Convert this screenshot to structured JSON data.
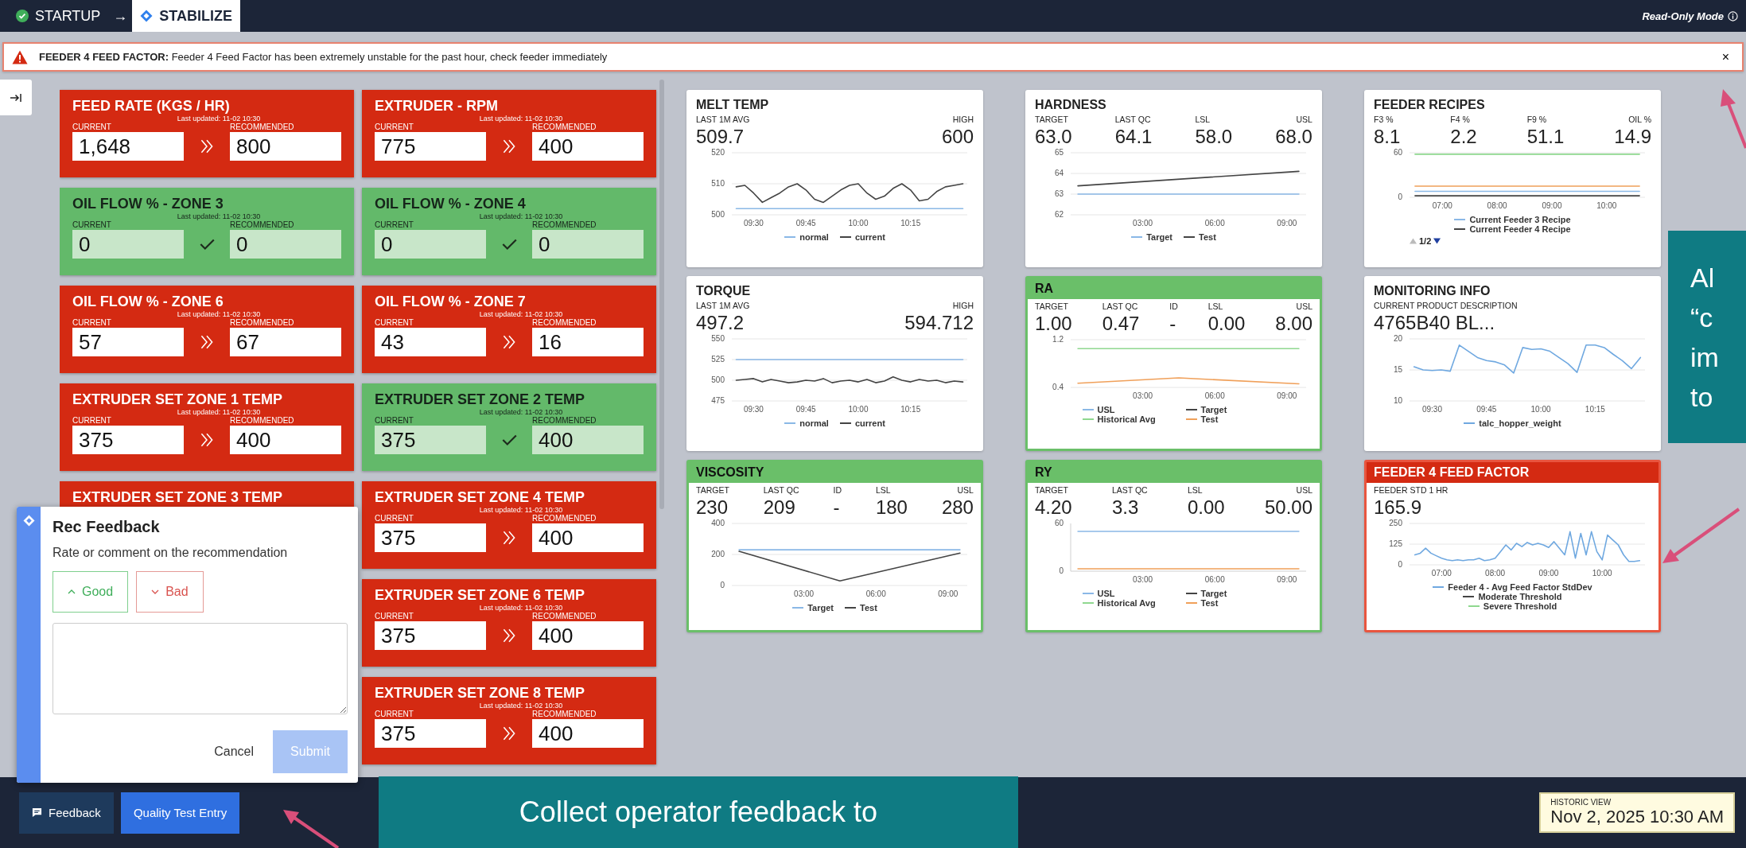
{
  "topbar": {
    "steps": [
      {
        "label": "STARTUP",
        "kind": "done",
        "selected": false
      },
      {
        "label": "STABILIZE",
        "kind": "current",
        "selected": true
      }
    ],
    "step_separator": "→",
    "mode": "Read-Only Mode"
  },
  "alert": {
    "title": "FEEDER 4 FEED FACTOR:",
    "message": "Feeder 4 Feed Factor has been extremely unstable for the past hour, check feeder immediately",
    "close": "×"
  },
  "setpoints": {
    "columns": [
      [
        {
          "title": "FEED RATE (KGS / HR)",
          "kind": "alert",
          "updated": "Last updated: 11-02 10:30",
          "current_label": "CURRENT",
          "current": "1,648",
          "recommended_label": "RECOMMENDED",
          "recommended": "800"
        },
        {
          "title": "OIL FLOW % - ZONE 3",
          "kind": "ok",
          "updated": "Last updated: 11-02 10:30",
          "current_label": "CURRENT",
          "current": "0",
          "recommended_label": "RECOMMENDED",
          "recommended": "0"
        },
        {
          "title": "OIL FLOW % - ZONE 6",
          "kind": "alert",
          "updated": "Last updated: 11-02 10:30",
          "current_label": "CURRENT",
          "current": "57",
          "recommended_label": "RECOMMENDED",
          "recommended": "67"
        },
        {
          "title": "EXTRUDER SET ZONE 1 TEMP",
          "kind": "alert",
          "updated": "Last updated: 11-02 10:30",
          "current_label": "CURRENT",
          "current": "375",
          "recommended_label": "RECOMMENDED",
          "recommended": "400"
        },
        {
          "title": "EXTRUDER SET ZONE 3 TEMP",
          "kind": "alert"
        }
      ],
      [
        {
          "title": "EXTRUDER - RPM",
          "kind": "alert",
          "updated": "Last updated: 11-02 10:30",
          "current_label": "CURRENT",
          "current": "775",
          "recommended_label": "RECOMMENDED",
          "recommended": "400"
        },
        {
          "title": "OIL FLOW % - ZONE 4",
          "kind": "ok",
          "updated": "Last updated: 11-02 10:30",
          "current_label": "CURRENT",
          "current": "0",
          "recommended_label": "RECOMMENDED",
          "recommended": "0"
        },
        {
          "title": "OIL FLOW % - ZONE 7",
          "kind": "alert",
          "updated": "Last updated: 11-02 10:30",
          "current_label": "CURRENT",
          "current": "43",
          "recommended_label": "RECOMMENDED",
          "recommended": "16"
        },
        {
          "title": "EXTRUDER SET ZONE 2 TEMP",
          "kind": "ok",
          "updated": "Last updated: 11-02 10:30",
          "current_label": "CURRENT",
          "current": "375",
          "recommended_label": "RECOMMENDED",
          "recommended": "400"
        },
        {
          "title": "EXTRUDER SET ZONE 4 TEMP",
          "kind": "alert",
          "updated": "Last updated: 11-02 10:30",
          "current_label": "CURRENT",
          "current": "375",
          "recommended_label": "RECOMMENDED",
          "recommended": "400"
        },
        {
          "title": "EXTRUDER SET ZONE 6 TEMP",
          "kind": "alert",
          "updated": "Last updated: 11-02 10:30",
          "current_label": "CURRENT",
          "current": "375",
          "recommended_label": "RECOMMENDED",
          "recommended": "400"
        },
        {
          "title": "EXTRUDER SET ZONE 8 TEMP",
          "kind": "alert",
          "updated": "Last updated: 11-02 10:30",
          "current_label": "CURRENT",
          "current": "375",
          "recommended_label": "RECOMMENDED",
          "recommended": "400"
        }
      ]
    ]
  },
  "panels": [
    {
      "title": "MELT TEMP",
      "kind": "plain",
      "stats": [
        {
          "label": "LAST 1M AVG",
          "value": "509.7"
        },
        {
          "label": "HIGH",
          "value": "600"
        }
      ],
      "chart_data": {
        "type": "line",
        "grid": true,
        "categories": [
          null,
          null,
          "09:30",
          null,
          null,
          null,
          null,
          null,
          "09:45",
          null,
          null,
          null,
          null,
          null,
          "10:00",
          null,
          null,
          null,
          null,
          null,
          "10:15",
          null,
          null,
          null,
          null,
          null,
          null
        ],
        "ylim": [
          500,
          520
        ],
        "yticks": [
          500,
          510,
          520
        ],
        "series": [
          {
            "name": "normal",
            "color": "#8ab8e6",
            "values": [
              502,
              502,
              502,
              502,
              502,
              502,
              502,
              502,
              502,
              502,
              502,
              502,
              502,
              502,
              502,
              502,
              502,
              502,
              502,
              502,
              502,
              502,
              502,
              502,
              502,
              502,
              502
            ]
          },
          {
            "name": "current",
            "color": "#444444",
            "values": [
              509,
              509.5,
              507,
              504,
              505.5,
              507,
              509,
              510,
              508,
              505,
              504,
              506,
              508,
              509.5,
              510,
              507,
              505,
              506,
              508.5,
              510,
              508,
              504.5,
              505,
              507.5,
              509,
              509.5,
              510
            ]
          }
        ]
      }
    },
    {
      "title": "HARDNESS",
      "kind": "plain",
      "stats": [
        {
          "label": "TARGET",
          "value": "63.0"
        },
        {
          "label": "LAST QC",
          "value": "64.1"
        },
        {
          "label": "LSL",
          "value": "58.0"
        },
        {
          "label": "USL",
          "value": "68.0"
        }
      ],
      "chart_data": {
        "type": "line",
        "grid": true,
        "x": [
          0.3,
          9.5
        ],
        "xlim": [
          0,
          9.8
        ],
        "ylim": [
          62,
          65
        ],
        "yticks": [
          62,
          63,
          64,
          65
        ],
        "xticks": [
          {
            "value": 3,
            "label": "03:00"
          },
          {
            "value": 6,
            "label": "06:00"
          },
          {
            "value": 9,
            "label": "09:00"
          }
        ],
        "series": [
          {
            "name": "Target",
            "color": "#8ab8e6",
            "values": [
              63,
              63
            ]
          },
          {
            "name": "Test",
            "color": "#444444",
            "values": [
              63.4,
              64.1
            ]
          }
        ]
      }
    },
    {
      "title": "FEEDER RECIPES",
      "kind": "plain",
      "stats": [
        {
          "label": "F3 %",
          "value": "8.1"
        },
        {
          "label": "F4 %",
          "value": "2.2"
        },
        {
          "label": "F9 %",
          "value": "51.1"
        },
        {
          "label": "OIL %",
          "value": "14.9"
        }
      ],
      "legend_pager": {
        "label": "1/2",
        "prev_disabled": true,
        "next_disabled": false
      },
      "chart_data": {
        "type": "line",
        "grid": true,
        "x": [
          6.5,
          10.6
        ],
        "xlim": [
          6.4,
          10.7
        ],
        "ylim": [
          0,
          60
        ],
        "yticks": [
          0,
          60
        ],
        "xticks": [
          {
            "value": 7,
            "label": "07:00"
          },
          {
            "value": 8,
            "label": "08:00"
          },
          {
            "value": 9,
            "label": "09:00"
          },
          {
            "value": 10,
            "label": "10:00"
          }
        ],
        "series": [
          {
            "name": "Current Feeder 3 Recipe",
            "color": "#8ab8e6",
            "values": [
              8,
              8
            ]
          },
          {
            "name": "Current Feeder 4 Recipe",
            "color": "#444444",
            "values": [
              2,
              2
            ]
          },
          {
            "name": null,
            "color": "#f0a05a",
            "values": [
              15,
              15
            ]
          },
          {
            "name": null,
            "color": "#8fd88f",
            "values": [
              58,
              58
            ]
          }
        ]
      }
    },
    {
      "title": "TORQUE",
      "kind": "plain",
      "stats": [
        {
          "label": "LAST 1M AVG",
          "value": "497.2"
        },
        {
          "label": "HIGH",
          "value": "594.712"
        }
      ],
      "chart_data": {
        "type": "line",
        "grid": true,
        "categories": [
          null,
          null,
          "09:30",
          null,
          null,
          null,
          null,
          null,
          "09:45",
          null,
          null,
          null,
          null,
          null,
          "10:00",
          null,
          null,
          null,
          null,
          null,
          "10:15",
          null,
          null,
          null,
          null,
          null,
          null
        ],
        "ylim": [
          475,
          550
        ],
        "yticks": [
          475,
          500,
          525,
          550
        ],
        "series": [
          {
            "name": "normal",
            "color": "#8ab8e6",
            "values": [
              525,
              525,
              525,
              525,
              525,
              525,
              525,
              525,
              525,
              525,
              525,
              525,
              525,
              525,
              525,
              525,
              525,
              525,
              525,
              525,
              525,
              525,
              525,
              525,
              525,
              525,
              525
            ]
          },
          {
            "name": "current",
            "color": "#444444",
            "values": [
              500,
              501,
              502,
              498,
              501,
              499,
              497,
              498,
              500,
              499,
              502,
              497,
              499,
              500,
              498,
              501,
              497,
              499,
              504,
              500,
              498,
              501,
              499,
              500,
              497,
              499,
              498
            ]
          }
        ]
      }
    },
    {
      "title": "RA",
      "kind": "ok",
      "stats": [
        {
          "label": "TARGET",
          "value": "1.00"
        },
        {
          "label": "LAST QC",
          "value": "0.47"
        },
        {
          "label": "ID",
          "value": "-"
        },
        {
          "label": "LSL",
          "value": "0.00"
        },
        {
          "label": "USL",
          "value": "8.00"
        }
      ],
      "chart_data": {
        "type": "line",
        "grid": true,
        "x": [
          0.3,
          4.5,
          9.5
        ],
        "xlim": [
          0,
          9.8
        ],
        "ylim": [
          0.4,
          1.2
        ],
        "yticks": [
          0.4,
          1.2
        ],
        "xticks": [
          {
            "value": 3,
            "label": "03:00"
          },
          {
            "value": 6,
            "label": "06:00"
          },
          {
            "value": 9,
            "label": "09:00"
          }
        ],
        "series": [
          {
            "name": "USL",
            "color": "#8ab8e6",
            "values": [
              null,
              null,
              null
            ]
          },
          {
            "name": "Target",
            "color": "#444444",
            "values": [
              null,
              null,
              null
            ]
          },
          {
            "name": "Historical Avg",
            "color": "#8fd88f",
            "values": [
              1.05,
              1.05,
              1.05
            ]
          },
          {
            "name": "Test",
            "color": "#f0a05a",
            "values": [
              0.47,
              0.56,
              0.46
            ]
          }
        ]
      }
    },
    {
      "title": "MONITORING INFO",
      "kind": "plain",
      "stats": [
        {
          "label": "CURRENT PRODUCT DESCRIPTION",
          "value": "4765B40 BL..."
        }
      ],
      "chart_data": {
        "type": "line",
        "grid": true,
        "categories": [
          null,
          null,
          "09:30",
          null,
          null,
          null,
          null,
          null,
          "09:45",
          null,
          null,
          null,
          null,
          null,
          "10:00",
          null,
          null,
          null,
          null,
          null,
          "10:15",
          null,
          null,
          null,
          null,
          null
        ],
        "ylim": [
          10,
          20
        ],
        "yticks": [
          10,
          15,
          20
        ],
        "series": [
          {
            "name": "talc_hopper_weight",
            "color": "#6fa8e0",
            "values": [
              15.5,
              15,
              14.9,
              15,
              14.8,
              19,
              18,
              17,
              16.5,
              16.3,
              15.8,
              14.5,
              18.6,
              18.3,
              18.4,
              18,
              17,
              16,
              14.6,
              19,
              19,
              18.6,
              17.5,
              16.5,
              15.2,
              17
            ]
          }
        ]
      }
    },
    {
      "title": "VISCOSITY",
      "kind": "ok",
      "stats": [
        {
          "label": "TARGET",
          "value": "230"
        },
        {
          "label": "LAST QC",
          "value": "209"
        },
        {
          "label": "ID",
          "value": "-"
        },
        {
          "label": "LSL",
          "value": "180"
        },
        {
          "label": "USL",
          "value": "280"
        }
      ],
      "chart_data": {
        "type": "line",
        "grid": true,
        "x": [
          0.3,
          4.5,
          9.5
        ],
        "xlim": [
          0,
          9.8
        ],
        "ylim": [
          0,
          400
        ],
        "yticks": [
          0,
          200,
          400
        ],
        "xticks": [
          {
            "value": 3,
            "label": "03:00"
          },
          {
            "value": 6,
            "label": "06:00"
          },
          {
            "value": 9,
            "label": "09:00"
          }
        ],
        "series": [
          {
            "name": "Target",
            "color": "#8ab8e6",
            "values": [
              230,
              230,
              230
            ]
          },
          {
            "name": "Test",
            "color": "#444444",
            "values": [
              220,
              30,
              209
            ]
          }
        ]
      }
    },
    {
      "title": "RY",
      "kind": "ok",
      "stats": [
        {
          "label": "TARGET",
          "value": "4.20"
        },
        {
          "label": "LAST QC",
          "value": "3.3"
        },
        {
          "label": "LSL",
          "value": "0.00"
        },
        {
          "label": "USL",
          "value": "50.00"
        }
      ],
      "chart_data": {
        "type": "line",
        "grid": false,
        "x": [
          0.3,
          9.5
        ],
        "xlim": [
          0,
          9.8
        ],
        "ylim": [
          0,
          60
        ],
        "yticks": [
          0,
          60
        ],
        "xticks": [
          {
            "value": 3,
            "label": "03:00"
          },
          {
            "value": 6,
            "label": "06:00"
          },
          {
            "value": 9,
            "label": "09:00"
          }
        ],
        "series": [
          {
            "name": "USL",
            "color": "#8ab8e6",
            "values": [
              50,
              50
            ]
          },
          {
            "name": "Target",
            "color": "#444444",
            "values": [
              null,
              null
            ]
          },
          {
            "name": "Historical Avg",
            "color": "#8fd88f",
            "values": [
              null,
              null
            ]
          },
          {
            "name": "Test",
            "color": "#f0a05a",
            "values": [
              3,
              3
            ]
          }
        ]
      }
    },
    {
      "title": "FEEDER 4 FEED FACTOR",
      "kind": "alert",
      "stats": [
        {
          "label": "FEEDER STD 1 HR",
          "value": "165.9"
        }
      ],
      "chart_data": {
        "type": "line",
        "grid": true,
        "x": [
          6.5,
          6.6,
          6.7,
          6.8,
          6.9,
          7.0,
          7.1,
          7.2,
          7.3,
          7.4,
          7.5,
          7.6,
          7.7,
          7.8,
          7.9,
          8.0,
          8.1,
          8.2,
          8.3,
          8.4,
          8.5,
          8.6,
          8.7,
          8.8,
          8.9,
          9.0,
          9.1,
          9.2,
          9.3,
          9.4,
          9.5,
          9.6,
          9.7,
          9.8,
          9.9,
          10.0,
          10.1,
          10.2,
          10.3,
          10.4,
          10.5,
          10.6,
          10.7
        ],
        "xlim": [
          6.4,
          10.8
        ],
        "ylim": [
          0,
          250
        ],
        "yticks": [
          0,
          125,
          250
        ],
        "xticks": [
          {
            "value": 7,
            "label": "07:00"
          },
          {
            "value": 8,
            "label": "08:00"
          },
          {
            "value": 9,
            "label": "09:00"
          },
          {
            "value": 10,
            "label": "10:00"
          }
        ],
        "series": [
          {
            "name": "Feeder 4 - Avg Feed Factor StdDev",
            "color": "#6fa8e0",
            "values": [
              60,
              70,
              100,
              70,
              55,
              40,
              30,
              25,
              30,
              25,
              30,
              30,
              40,
              25,
              30,
              40,
              80,
              120,
              90,
              130,
              110,
              135,
              120,
              130,
              120,
              105,
              140,
              100,
              60,
              200,
              40,
              190,
              60,
              200,
              80,
              30,
              180,
              150,
              120,
              60,
              20,
              20,
              25
            ]
          },
          {
            "name": "Moderate Threshold",
            "color": "#444444",
            "values": [
              null,
              null,
              null,
              null,
              null,
              null,
              null,
              null,
              null,
              null,
              null,
              null,
              null,
              null,
              null,
              null,
              null,
              null,
              null,
              null,
              null,
              null,
              null,
              null,
              null,
              null,
              null,
              null,
              null,
              null,
              null,
              null,
              null,
              null,
              null,
              null,
              null,
              null,
              null,
              null,
              null,
              null,
              null
            ]
          },
          {
            "name": "Severe Threshold",
            "color": "#8fd88f",
            "values": [
              null,
              null,
              null,
              null,
              null,
              null,
              null,
              null,
              null,
              null,
              null,
              null,
              null,
              null,
              null,
              null,
              null,
              null,
              null,
              null,
              null,
              null,
              null,
              null,
              null,
              null,
              null,
              null,
              null,
              null,
              null,
              null,
              null,
              null,
              null,
              null,
              null,
              null,
              null,
              null,
              null,
              null,
              null
            ]
          }
        ]
      }
    }
  ],
  "feedback_popup": {
    "title": "Rec Feedback",
    "prompt": "Rate or comment on the recommendation",
    "good": "Good",
    "bad": "Bad",
    "cancel": "Cancel",
    "submit": {
      "label": "Submit",
      "disabled": true
    }
  },
  "bottombar": {
    "buttons": [
      {
        "label": "Feedback",
        "kind": "secondary"
      },
      {
        "label": "Quality Test Entry",
        "kind": "primary"
      }
    ],
    "historic_label": "HISTORIC VIEW",
    "historic_value": "Nov 2, 2025 10:30 AM"
  },
  "annotations": [
    {
      "kind": "side",
      "lines": [
        "Al",
        "“c",
        "im",
        "to"
      ]
    },
    {
      "kind": "bottom",
      "lines": [
        "Collect operator feedback to"
      ]
    }
  ]
}
